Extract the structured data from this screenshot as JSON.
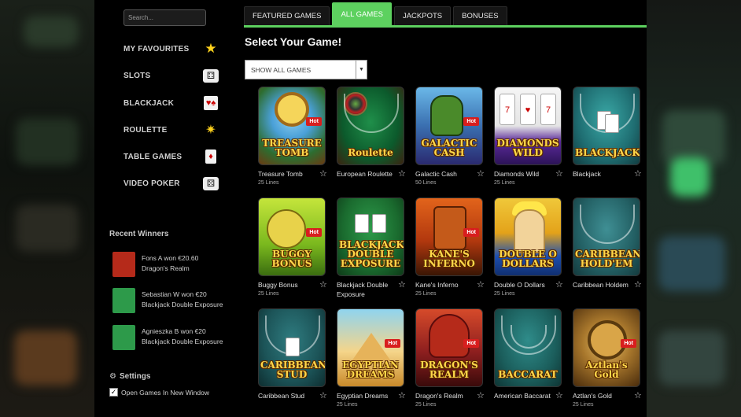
{
  "search": {
    "placeholder": "Search..."
  },
  "sidebar": {
    "items": [
      {
        "label": "MY FAVOURITES",
        "icon": "star-icon"
      },
      {
        "label": "SLOTS",
        "icon": "dice-icon"
      },
      {
        "label": "BLACKJACK",
        "icon": "cards-icon"
      },
      {
        "label": "ROULETTE",
        "icon": "roulette-icon"
      },
      {
        "label": "TABLE GAMES",
        "icon": "playing-card-icon"
      },
      {
        "label": "VIDEO POKER",
        "icon": "dice-icon"
      }
    ],
    "recent_winners_title": "Recent Winners",
    "winners": [
      {
        "line1": "Fons A won €20.60",
        "line2": "Dragon's Realm",
        "thumb_color": "#b52a1a"
      },
      {
        "line1": "Sebastian W won €20",
        "line2": "Blackjack Double Exposure",
        "thumb_color": "#2d9a4a"
      },
      {
        "line1": "Agnieszka B won €20",
        "line2": "Blackjack Double Exposure",
        "thumb_color": "#2d9a4a"
      }
    ],
    "settings_title": "Settings",
    "open_new_window_label": "Open Games In New Window",
    "open_new_window_checked": true
  },
  "main": {
    "tabs": [
      {
        "label": "FEATURED GAMES",
        "active": false
      },
      {
        "label": "ALL GAMES",
        "active": true
      },
      {
        "label": "JACKPOTS",
        "active": false
      },
      {
        "label": "BONUSES",
        "active": false
      }
    ],
    "title": "Select Your Game!",
    "filter_selected": "SHOW ALL GAMES",
    "hot_label": "Hot",
    "games": [
      {
        "name": "Treasure Tomb",
        "lines": "25 Lines",
        "art_title": "TREASURE TOMB",
        "art": "treasure",
        "hot": true
      },
      {
        "name": "European Roulette",
        "lines": "",
        "art_title": "Roulette",
        "art": "roulette",
        "hot": false
      },
      {
        "name": "Galactic Cash",
        "lines": "50 Lines",
        "art_title": "GALACTIC CASH",
        "art": "galactic",
        "hot": true
      },
      {
        "name": "Diamonds Wild",
        "lines": "25 Lines",
        "art_title": "DIAMONDS WILD",
        "art": "diamonds",
        "hot": false
      },
      {
        "name": "Blackjack",
        "lines": "",
        "art_title": "BLACKJACK",
        "art": "blackjack",
        "hot": false
      },
      {
        "name": "Buggy Bonus",
        "lines": "25 Lines",
        "art_title": "BUGGY BONUS",
        "art": "buggy",
        "hot": true
      },
      {
        "name": "Blackjack Double Exposure",
        "lines": "",
        "art_title": "BLACKJACK DOUBLE EXPOSURE",
        "art": "bjdouble",
        "hot": false
      },
      {
        "name": "Kane's Inferno",
        "lines": "25 Lines",
        "art_title": "KANE'S INFERNO",
        "art": "kane",
        "hot": true
      },
      {
        "name": "Double O Dollars",
        "lines": "25 Lines",
        "art_title": "DOUBLE O DOLLARS",
        "art": "double",
        "hot": false
      },
      {
        "name": "Caribbean Holdem",
        "lines": "",
        "art_title": "CARIBBEAN HOLD'EM",
        "art": "caribbean",
        "hot": false
      },
      {
        "name": "Caribbean Stud",
        "lines": "",
        "art_title": "CARIBBEAN STUD",
        "art": "caribstud",
        "hot": false
      },
      {
        "name": "Egyptian Dreams",
        "lines": "25 Lines",
        "art_title": "EGYPTIAN DREAMS",
        "art": "egypt",
        "hot": true
      },
      {
        "name": "Dragon's Realm",
        "lines": "25 Lines",
        "art_title": "DRAGON'S REALM",
        "art": "dragon",
        "hot": true
      },
      {
        "name": "American Baccarat",
        "lines": "",
        "art_title": "BACCARAT",
        "art": "baccarat",
        "hot": false
      },
      {
        "name": "Aztlan's Gold",
        "lines": "25 Lines",
        "art_title": "Aztlan's Gold",
        "art": "aztlan",
        "hot": true
      }
    ]
  }
}
